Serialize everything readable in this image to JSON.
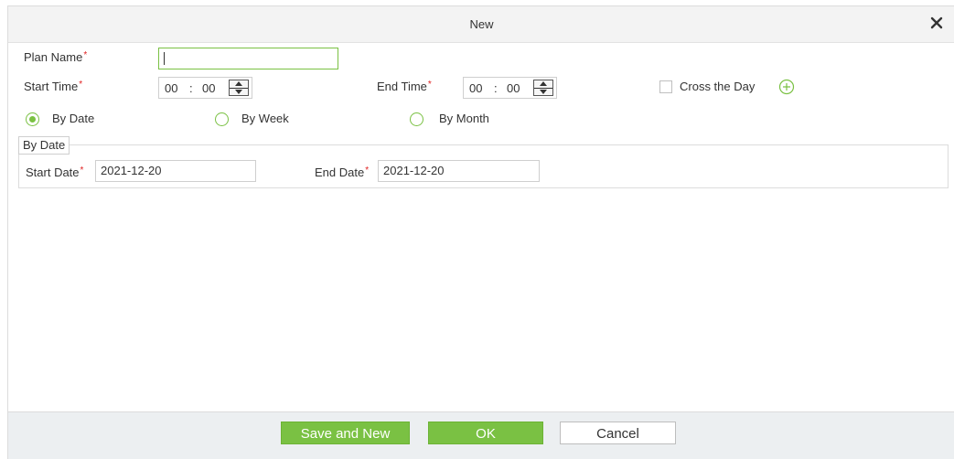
{
  "dialog": {
    "title": "New",
    "close_icon": "close-icon"
  },
  "form": {
    "plan_name": {
      "label": "Plan Name",
      "required_mark": "*",
      "value": ""
    },
    "start_time": {
      "label": "Start Time",
      "required_mark": "*",
      "hours": "00",
      "separator": ":",
      "minutes": "00"
    },
    "end_time": {
      "label": "End Time",
      "required_mark": "*",
      "hours": "00",
      "separator": ":",
      "minutes": "00"
    },
    "cross_the_day": {
      "label": "Cross the Day",
      "checked": false,
      "add_icon": "plus-circle-icon"
    },
    "schedule_type": {
      "options": [
        "By Date",
        "By Week",
        "By Month"
      ],
      "selected": "By Date"
    },
    "by_date_group": {
      "legend": "By Date",
      "start_date": {
        "label": "Start Date",
        "required_mark": "*",
        "value": "2021-12-20"
      },
      "end_date": {
        "label": "End Date",
        "required_mark": "*",
        "value": "2021-12-20"
      }
    }
  },
  "footer": {
    "save_and_new": "Save and New",
    "ok": "OK",
    "cancel": "Cancel"
  },
  "colors": {
    "accent": "#7ac143",
    "required": "#e02020",
    "footer_bg": "#eceff1",
    "titlebar_bg": "#f3f3f3"
  }
}
